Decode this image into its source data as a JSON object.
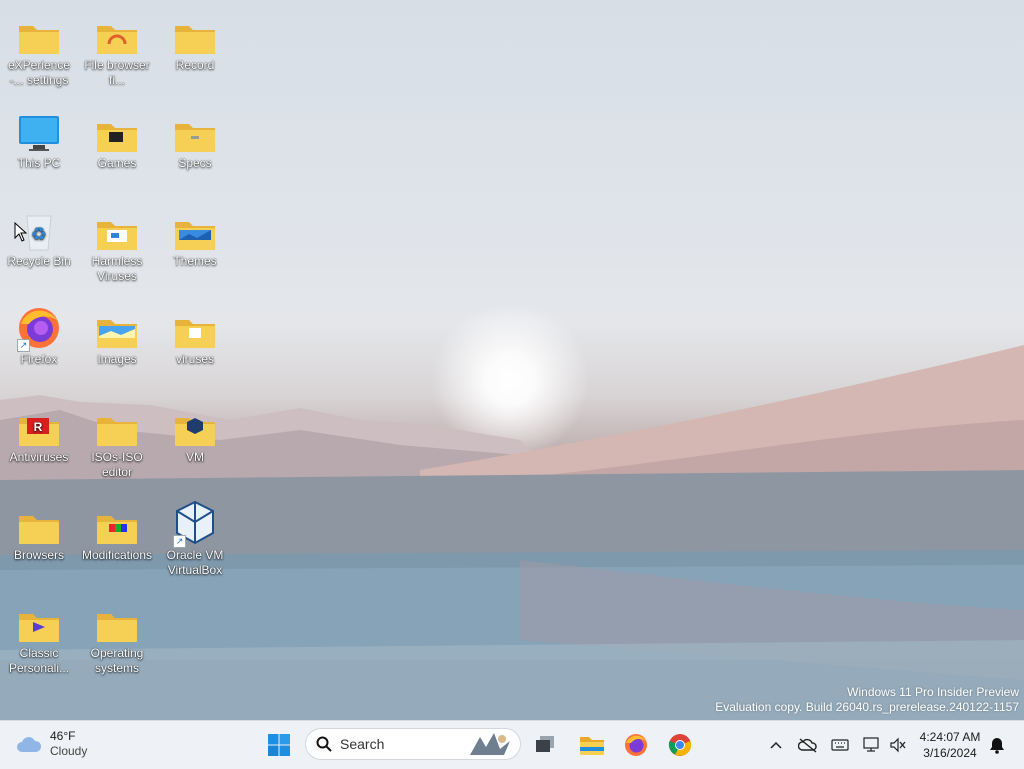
{
  "desktop": {
    "icons": [
      {
        "label": "eXPerience -... settings"
      },
      {
        "label": "File browser fi..."
      },
      {
        "label": "Record"
      },
      {
        "label": "This PC"
      },
      {
        "label": "Games"
      },
      {
        "label": "Specs"
      },
      {
        "label": "Recycle Bin"
      },
      {
        "label": "Harmless Viruses"
      },
      {
        "label": "Themes"
      },
      {
        "label": "Firefox"
      },
      {
        "label": "Images"
      },
      {
        "label": "viruses"
      },
      {
        "label": "Antiviruses"
      },
      {
        "label": "ISOs-ISO editor"
      },
      {
        "label": "VM"
      },
      {
        "label": "Browsers"
      },
      {
        "label": "Modifications"
      },
      {
        "label": "Oracle VM VirtualBox"
      },
      {
        "label": "Classic Personali..."
      },
      {
        "label": "Operating systems"
      }
    ],
    "watermark": {
      "line1": "Windows 11 Pro Insider Preview",
      "line2": "Evaluation copy. Build 26040.rs_prerelease.240122-1157"
    }
  },
  "taskbar": {
    "weather": {
      "temp": "46°F",
      "condition": "Cloudy",
      "icon": "cloud-icon"
    },
    "search": {
      "placeholder": "Search"
    },
    "apps": [
      "start-icon",
      "task-view-icon",
      "file-explorer-icon",
      "firefox-icon",
      "chrome-icon"
    ],
    "tray": [
      "chevron-up-icon",
      "onedrive-offline-icon",
      "keyboard-icon",
      "network-icon",
      "volume-muted-icon",
      "notification-bell-icon"
    ],
    "clock": {
      "time": "4:24:07 AM",
      "date": "3/16/2024"
    }
  },
  "colors": {
    "folder": "#f6cf55",
    "folder_dark": "#e8b33a",
    "taskbar_bg": "#eef1f5",
    "accent": "#0a78d4"
  }
}
